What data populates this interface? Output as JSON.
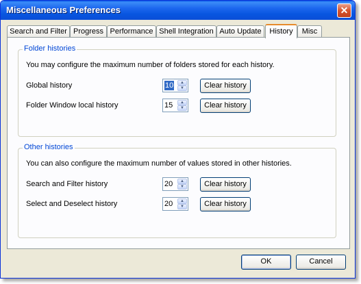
{
  "window": {
    "title": "Miscellaneous Preferences",
    "close_symbol": "✕"
  },
  "tabs": [
    {
      "label": "Search and Filter"
    },
    {
      "label": "Progress"
    },
    {
      "label": "Performance"
    },
    {
      "label": "Shell Integration"
    },
    {
      "label": "Auto Update"
    },
    {
      "label": "History"
    },
    {
      "label": "Misc"
    }
  ],
  "active_tab": "History",
  "folder_histories": {
    "title": "Folder histories",
    "description": "You may configure the maximum number of folders stored for each history.",
    "rows": [
      {
        "label": "Global history",
        "value": "10",
        "button": "Clear history"
      },
      {
        "label": "Folder Window local history",
        "value": "15",
        "button": "Clear history"
      }
    ]
  },
  "other_histories": {
    "title": "Other histories",
    "description": "You can also configure the maximum number of values stored in other histories.",
    "rows": [
      {
        "label": "Search and Filter history",
        "value": "20",
        "button": "Clear history"
      },
      {
        "label": "Select and Deselect history",
        "value": "20",
        "button": "Clear history"
      }
    ]
  },
  "footer": {
    "ok_label": "OK",
    "cancel_label": "Cancel"
  },
  "icons": {
    "spin_up": "▲",
    "spin_down": "▼"
  }
}
